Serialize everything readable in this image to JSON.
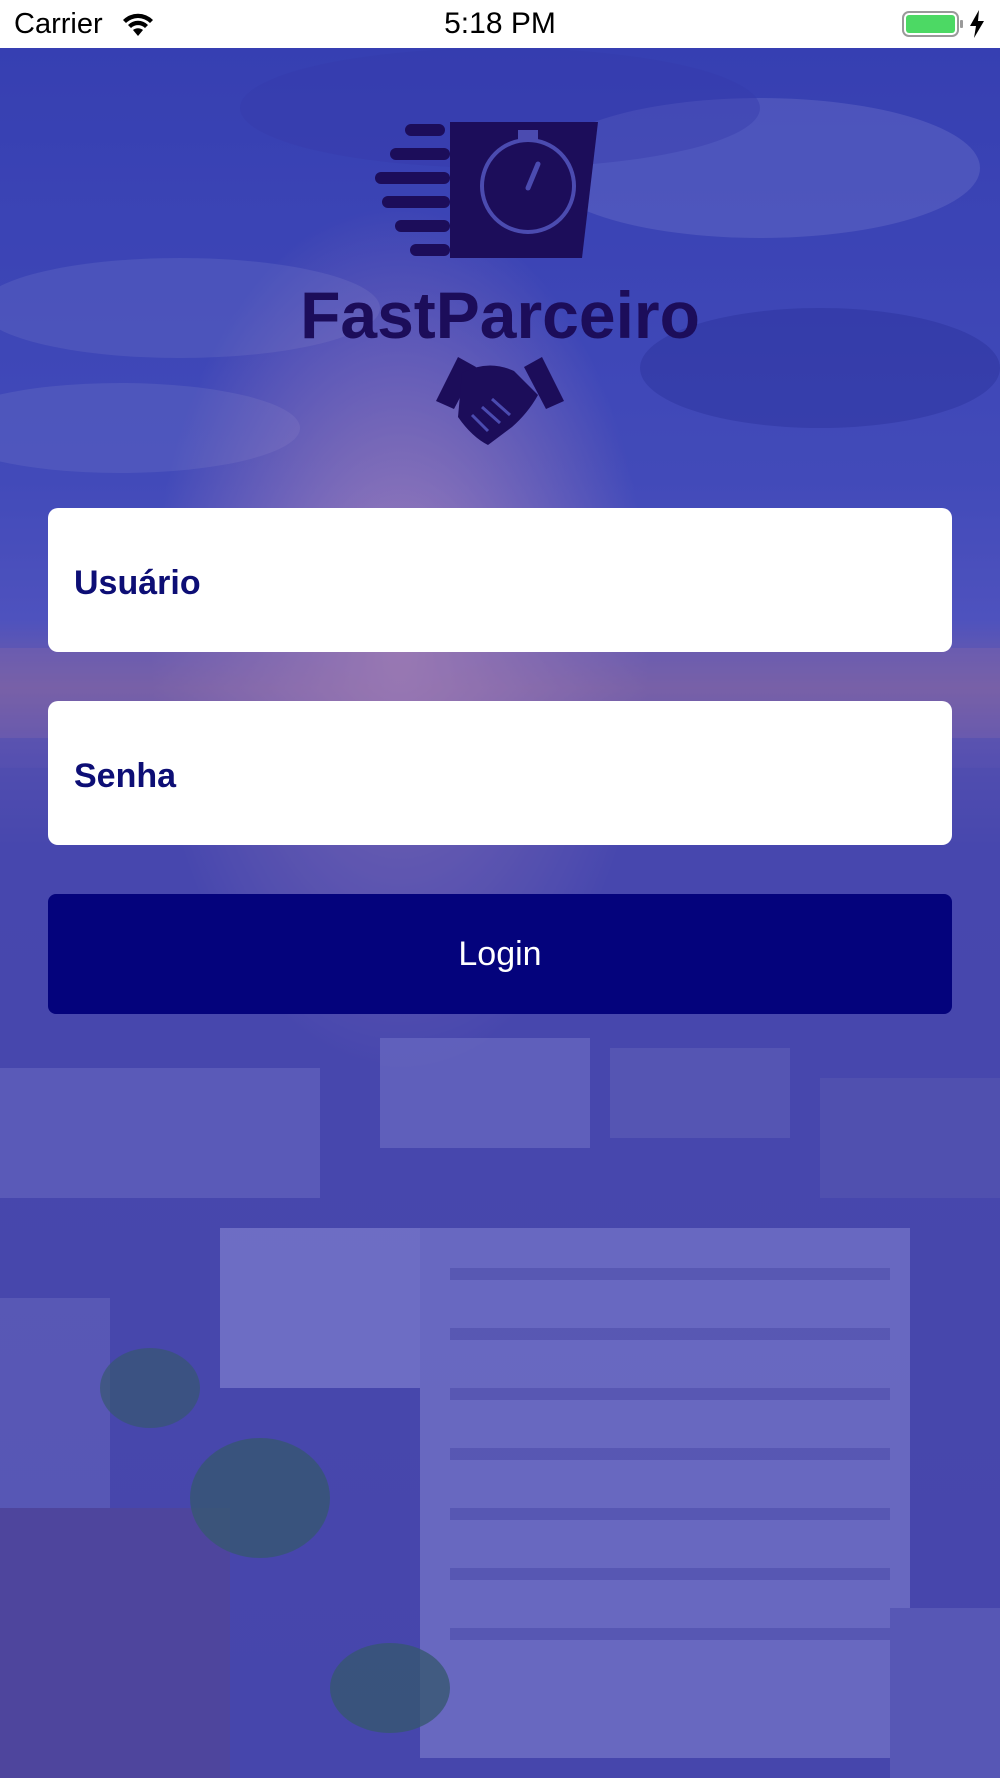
{
  "status_bar": {
    "carrier": "Carrier",
    "time": "5:18 PM"
  },
  "logo": {
    "brand": "FastParceiro",
    "icons": [
      "stopwatch-icon",
      "handshake-icon"
    ]
  },
  "form": {
    "username_placeholder": "Usuário",
    "password_placeholder": "Senha",
    "login_label": "Login"
  },
  "colors": {
    "accent": "#04037c",
    "placeholder": "#0d0e75",
    "overlay": "#2b2a9e"
  }
}
